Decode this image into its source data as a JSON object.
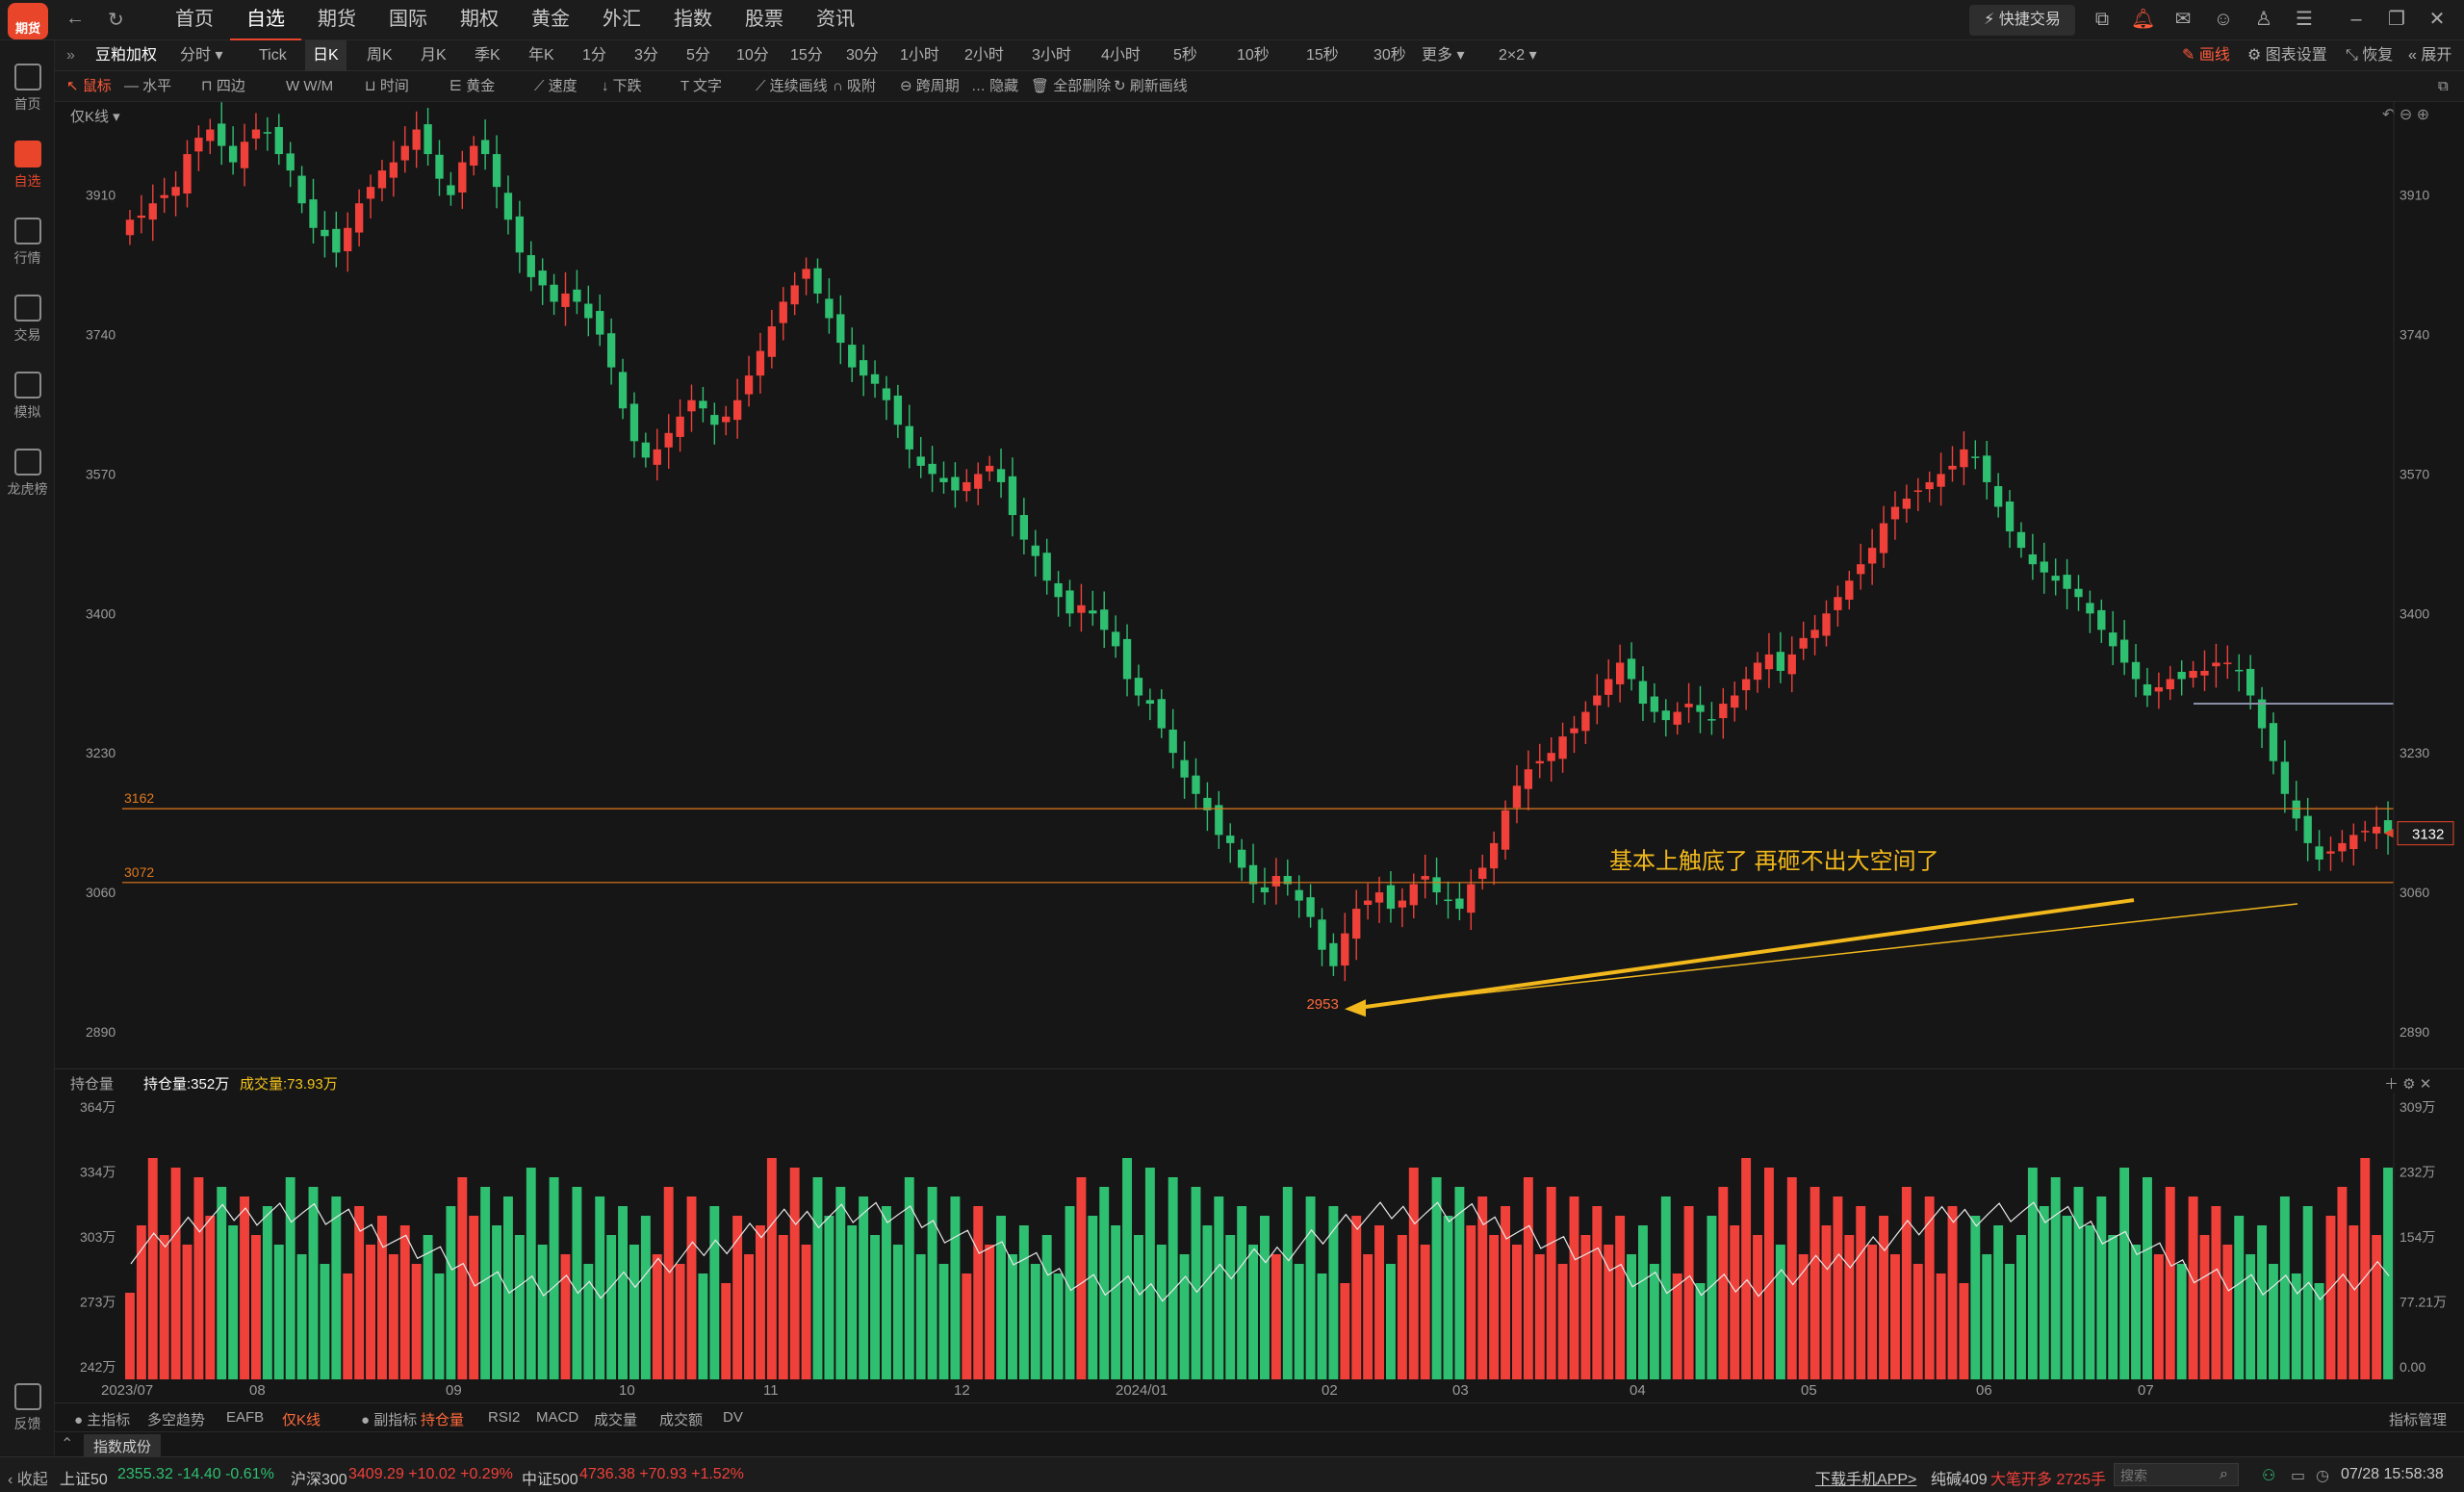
{
  "app": {
    "logo_text": "期货",
    "logo_top": "安"
  },
  "topnav": {
    "tabs": [
      "首页",
      "自选",
      "期货",
      "国际",
      "期权",
      "黄金",
      "外汇",
      "指数",
      "股票",
      "资讯"
    ],
    "active": 1,
    "quick_trade": "快捷交易"
  },
  "sidebar": {
    "items": [
      "首页",
      "自选",
      "行情",
      "交易",
      "模拟",
      "龙虎榜"
    ],
    "active": 1,
    "feedback": "反馈"
  },
  "toolbar1": {
    "symbol": "豆粕加权",
    "periods": [
      "分时",
      "Tick",
      "日K",
      "周K",
      "月K",
      "季K",
      "年K",
      "1分",
      "3分",
      "5分",
      "10分",
      "15分",
      "30分",
      "1小时",
      "2小时",
      "3小时",
      "4小时",
      "5秒",
      "10秒",
      "15秒",
      "30秒",
      "更多",
      "2×2"
    ],
    "active_period": "日K",
    "right": [
      "画线",
      "图表设置",
      "恢复",
      "展开"
    ]
  },
  "toolbar2": {
    "tools": [
      "鼠标",
      "水平",
      "四边",
      "W/M",
      "时间",
      "黄金",
      "速度",
      "下跌",
      "文字",
      "连续画线",
      "吸附",
      "跨周期",
      "隐藏",
      "全部删除",
      "刷新画线"
    ]
  },
  "main_chart": {
    "mode_label": "仅K线",
    "y_ticks": [
      "3910",
      "3740",
      "3570",
      "3400",
      "3230",
      "3060",
      "2890"
    ],
    "hlines": [
      {
        "label": "3162"
      },
      {
        "label": "3072"
      }
    ],
    "low_label": "2953",
    "annotation": "基本上触底了 再砸不出大空间了",
    "last_price": "3132",
    "colors": {
      "up": "#f0403a",
      "down": "#2fbf71",
      "hline": "#e0781e",
      "arrow": "#f2b81c"
    }
  },
  "volume": {
    "dropdown": "持仓量",
    "oi_label": "持仓量:352万",
    "vol_label": "成交量:73.93万",
    "left_ticks": [
      "364万",
      "334万",
      "303万",
      "273万",
      "242万"
    ],
    "right_ticks": [
      "309万",
      "232万",
      "154万",
      "77.21万",
      "0.00"
    ]
  },
  "x_axis": [
    "2023/07",
    "08",
    "09",
    "10",
    "11",
    "12",
    "2024/01",
    "02",
    "03",
    "04",
    "05",
    "06",
    "07"
  ],
  "indicator_tabs": [
    "主指标",
    "多空趋势",
    "EAFB",
    "仅K线",
    "副指标",
    "持仓量",
    "RSI2",
    "MACD",
    "成交量",
    "成交额",
    "DV"
  ],
  "indicator_manage": "指标管理",
  "bottom_tab": "指数成份",
  "statusbar": {
    "collapse": "收起",
    "indices": [
      {
        "name": "上证50",
        "value": "2355.32",
        "change": "-14.40",
        "pct": "-0.61%",
        "dir": "dn"
      },
      {
        "name": "沪深300",
        "value": "3409.29",
        "change": "+10.02",
        "pct": "+0.29%",
        "dir": "up"
      },
      {
        "name": "中证500",
        "value": "4736.38",
        "change": "+70.93",
        "pct": "+1.52%",
        "dir": "up"
      }
    ],
    "download": "下载手机APP>",
    "ticker": "纯碱409",
    "ticker_msg": "大笔开多 2725手",
    "search_placeholder": "搜索",
    "datetime": "07/28 15:58:38"
  },
  "chart_data": {
    "type": "candlestick",
    "title": "豆粕加权",
    "y_range": [
      2850,
      4000
    ],
    "closes": [
      3880,
      3885,
      3900,
      3910,
      3920,
      3960,
      3980,
      3990,
      3970,
      3950,
      3975,
      3990,
      3985,
      3960,
      3940,
      3900,
      3870,
      3860,
      3840,
      3870,
      3900,
      3920,
      3940,
      3950,
      3970,
      3990,
      3960,
      3930,
      3910,
      3950,
      3970,
      3960,
      3920,
      3880,
      3840,
      3810,
      3800,
      3780,
      3790,
      3780,
      3760,
      3740,
      3700,
      3650,
      3610,
      3590,
      3600,
      3620,
      3640,
      3660,
      3650,
      3630,
      3640,
      3660,
      3690,
      3720,
      3750,
      3780,
      3800,
      3820,
      3790,
      3760,
      3730,
      3700,
      3690,
      3680,
      3660,
      3630,
      3600,
      3580,
      3570,
      3560,
      3550,
      3560,
      3570,
      3580,
      3560,
      3520,
      3490,
      3470,
      3440,
      3420,
      3400,
      3410,
      3400,
      3380,
      3360,
      3320,
      3300,
      3290,
      3260,
      3230,
      3200,
      3180,
      3160,
      3130,
      3120,
      3090,
      3070,
      3060,
      3080,
      3070,
      3050,
      3030,
      2990,
      2970,
      3010,
      3040,
      3050,
      3060,
      3040,
      3050,
      3070,
      3080,
      3060,
      3050,
      3040,
      3070,
      3090,
      3120,
      3160,
      3190,
      3210,
      3220,
      3230,
      3250,
      3260,
      3280,
      3300,
      3320,
      3340,
      3320,
      3290,
      3280,
      3270,
      3280,
      3290,
      3280,
      3270,
      3290,
      3300,
      3320,
      3340,
      3350,
      3330,
      3350,
      3370,
      3380,
      3400,
      3420,
      3440,
      3460,
      3480,
      3510,
      3530,
      3540,
      3550,
      3560,
      3570,
      3580,
      3600,
      3590,
      3560,
      3530,
      3500,
      3480,
      3460,
      3450,
      3440,
      3430,
      3420,
      3400,
      3380,
      3360,
      3340,
      3320,
      3300,
      3310,
      3320,
      3320,
      3330,
      3330,
      3340,
      3340,
      3330,
      3300,
      3260,
      3220,
      3180,
      3150,
      3120,
      3100,
      3110,
      3120,
      3130,
      3135,
      3140,
      3132
    ],
    "horizontal_lines": [
      3162,
      3072
    ],
    "low": 2953,
    "last": 3132
  }
}
